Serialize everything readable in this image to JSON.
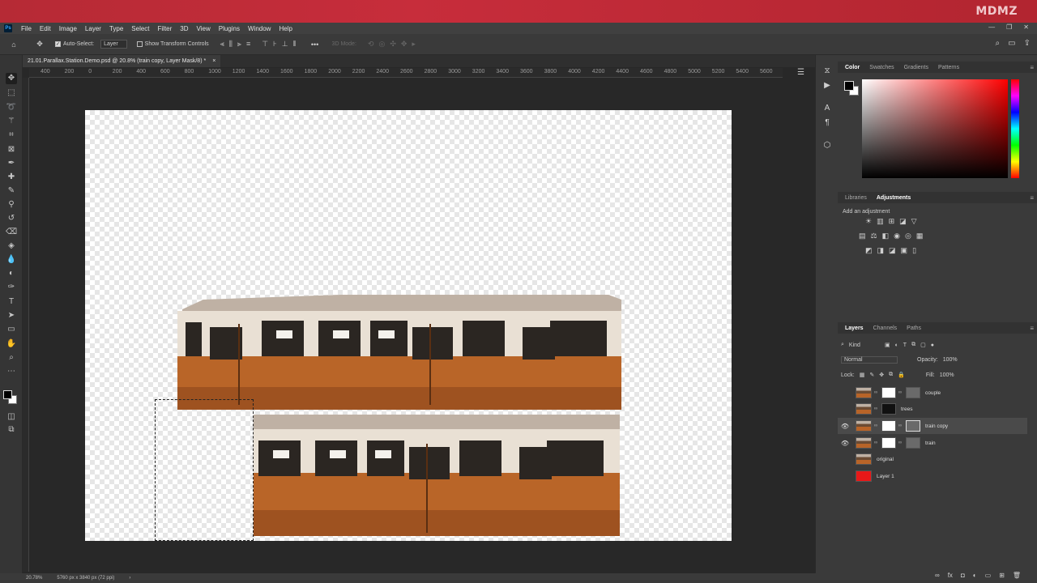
{
  "brand": {
    "logo_text": "MDMZ"
  },
  "menubar": {
    "items": [
      "File",
      "Edit",
      "Image",
      "Layer",
      "Type",
      "Select",
      "Filter",
      "3D",
      "View",
      "Plugins",
      "Window",
      "Help"
    ]
  },
  "options_bar": {
    "auto_select_label": "Auto-Select:",
    "auto_select_checked": true,
    "auto_select_target": "Layer",
    "transform_controls_label": "Show Transform Controls",
    "transform_controls_checked": false,
    "mode_3d_label": "3D Mode:"
  },
  "document": {
    "tab_title": "21.01.Parallax.Station.Demo.psd @ 20.8% (train copy, Layer Mask/8) *",
    "close_glyph": "×"
  },
  "ruler": {
    "labels": [
      "400",
      "200",
      "0",
      "200",
      "400",
      "600",
      "800",
      "1000",
      "1200",
      "1400",
      "1600",
      "1800",
      "2000",
      "2200",
      "2400",
      "2600",
      "2800",
      "3000",
      "3200",
      "3400",
      "3600",
      "3800",
      "4000",
      "4200",
      "4400",
      "4600",
      "4800",
      "5000",
      "5200",
      "5400",
      "5600",
      "5800",
      "6000"
    ]
  },
  "status_bar": {
    "zoom": "20.78%",
    "dimensions": "5760 px x 3840 px (72 ppi)",
    "arrow": "›"
  },
  "panels": {
    "color_tabs": [
      "Color",
      "Swatches",
      "Gradients",
      "Patterns"
    ],
    "color_active": "Color",
    "adjust_tabs": [
      "Libraries",
      "Adjustments"
    ],
    "adjust_active": "Adjustments",
    "add_adjustment_label": "Add an adjustment",
    "layers_tabs": [
      "Layers",
      "Channels",
      "Paths"
    ],
    "layers_active": "Layers",
    "kind_filter": "Kind",
    "blend_mode": "Normal",
    "opacity_label": "Opacity:",
    "opacity_value": "100%",
    "lock_label": "Lock:",
    "fill_label": "Fill:",
    "fill_value": "100%"
  },
  "layers": [
    {
      "name": "couple",
      "visible": false,
      "selected": false,
      "mask": "white",
      "thumb": "photo"
    },
    {
      "name": "trees",
      "visible": false,
      "selected": false,
      "mask": "dark",
      "thumb": "photo"
    },
    {
      "name": "train copy",
      "visible": true,
      "selected": true,
      "mask": "white",
      "thumb": "photo"
    },
    {
      "name": "train",
      "visible": true,
      "selected": false,
      "mask": "white",
      "thumb": "photo"
    },
    {
      "name": "original",
      "visible": false,
      "selected": false,
      "mask": "none",
      "thumb": "photo"
    },
    {
      "name": "Layer 1",
      "visible": false,
      "selected": false,
      "mask": "none",
      "thumb": "red"
    }
  ],
  "colors": {
    "brand_red": "#c72d3b",
    "ui_dark": "#282828",
    "panel": "#3a3a3a",
    "train_body": "#b86428",
    "train_roof": "#bfb1a4",
    "layer1_fill": "#e81818"
  },
  "icons": {
    "tools": [
      "move-tool-icon",
      "marquee-tool-icon",
      "lasso-tool-icon",
      "magic-wand-icon",
      "crop-tool-icon",
      "frame-tool-icon",
      "eyedropper-icon",
      "spot-heal-icon",
      "brush-tool-icon",
      "clone-stamp-icon",
      "history-brush-icon",
      "eraser-icon",
      "gradient-tool-icon",
      "blur-tool-icon",
      "dodge-tool-icon",
      "pen-tool-icon",
      "type-tool-icon",
      "path-select-icon",
      "rectangle-tool-icon",
      "hand-tool-icon",
      "zoom-tool-icon",
      "more-tools-icon"
    ]
  }
}
